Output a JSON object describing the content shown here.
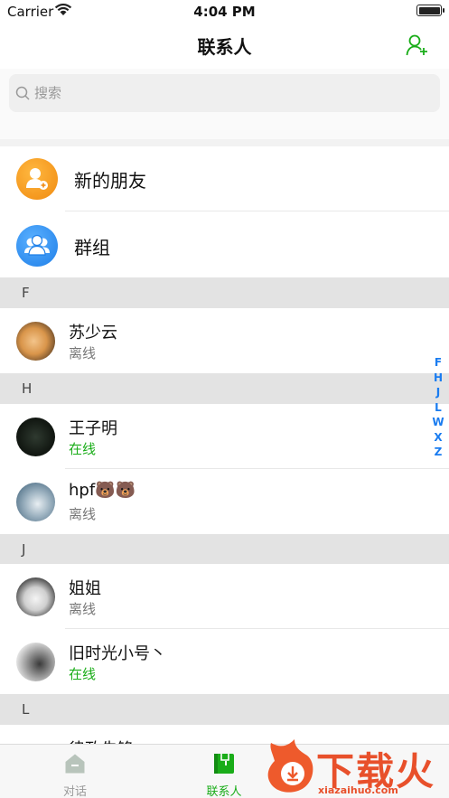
{
  "status_bar": {
    "carrier": "Carrier",
    "time": "4:04 PM"
  },
  "nav": {
    "title": "联系人",
    "add_icon": "add-user-icon"
  },
  "search": {
    "placeholder": "搜索"
  },
  "special_items": [
    {
      "label": "新的朋友",
      "icon": "new-friend-icon",
      "color": "#f5a21b"
    },
    {
      "label": "群组",
      "icon": "group-icon",
      "color": "#2b8df0"
    }
  ],
  "sections": [
    {
      "letter": "F",
      "contacts": [
        {
          "name": "苏少云",
          "status": "离线"
        }
      ]
    },
    {
      "letter": "H",
      "contacts": [
        {
          "name": "王子明",
          "status": "在线"
        },
        {
          "name": "hpf🐻🐻",
          "status": "离线"
        }
      ]
    },
    {
      "letter": "J",
      "contacts": [
        {
          "name": "姐姐",
          "status": "离线"
        },
        {
          "name": "旧时光小号丶",
          "status": "在线"
        }
      ]
    },
    {
      "letter": "L",
      "contacts": [
        {
          "name": "律政先锋",
          "status": ""
        }
      ]
    }
  ],
  "index_letters": [
    "F",
    "H",
    "J",
    "L",
    "W",
    "X",
    "Z"
  ],
  "tabs": [
    {
      "label": "对话",
      "icon": "chat-icon",
      "active": false
    },
    {
      "label": "联系人",
      "icon": "contacts-icon",
      "active": true
    }
  ],
  "watermark": {
    "text": "下载火",
    "url": "xiazaihuo.com"
  },
  "colors": {
    "accent": "#1aad19",
    "index": "#1a7cf0",
    "section_bg": "#e3e3e3"
  }
}
